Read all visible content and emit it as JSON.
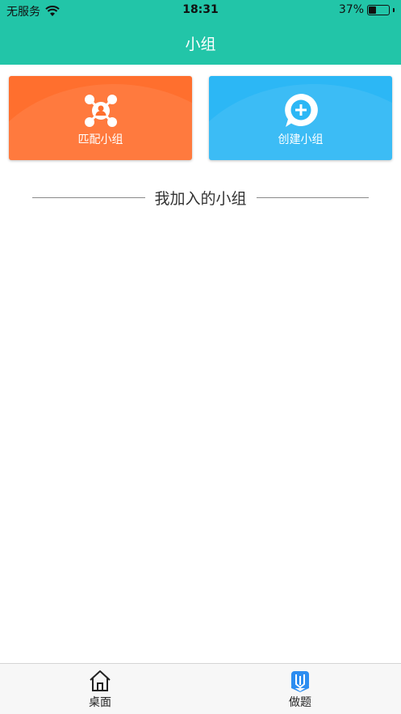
{
  "status_bar": {
    "carrier": "无服务",
    "time": "18:31",
    "battery_percent": "37%",
    "battery_level": 0.37
  },
  "header": {
    "title": "小组"
  },
  "cards": [
    {
      "label": "匹配小组",
      "icon": "group-network-icon",
      "color": "#ff6f2e"
    },
    {
      "label": "创建小组",
      "icon": "chat-plus-icon",
      "color": "#2cb7f5"
    }
  ],
  "section": {
    "title": "我加入的小组"
  },
  "tabbar": {
    "items": [
      {
        "label": "桌面",
        "icon": "home-icon"
      },
      {
        "label": "做题",
        "icon": "bookmark-book-icon",
        "active_color": "#2c8df0"
      }
    ]
  },
  "colors": {
    "header_bg": "#22c5a8"
  }
}
